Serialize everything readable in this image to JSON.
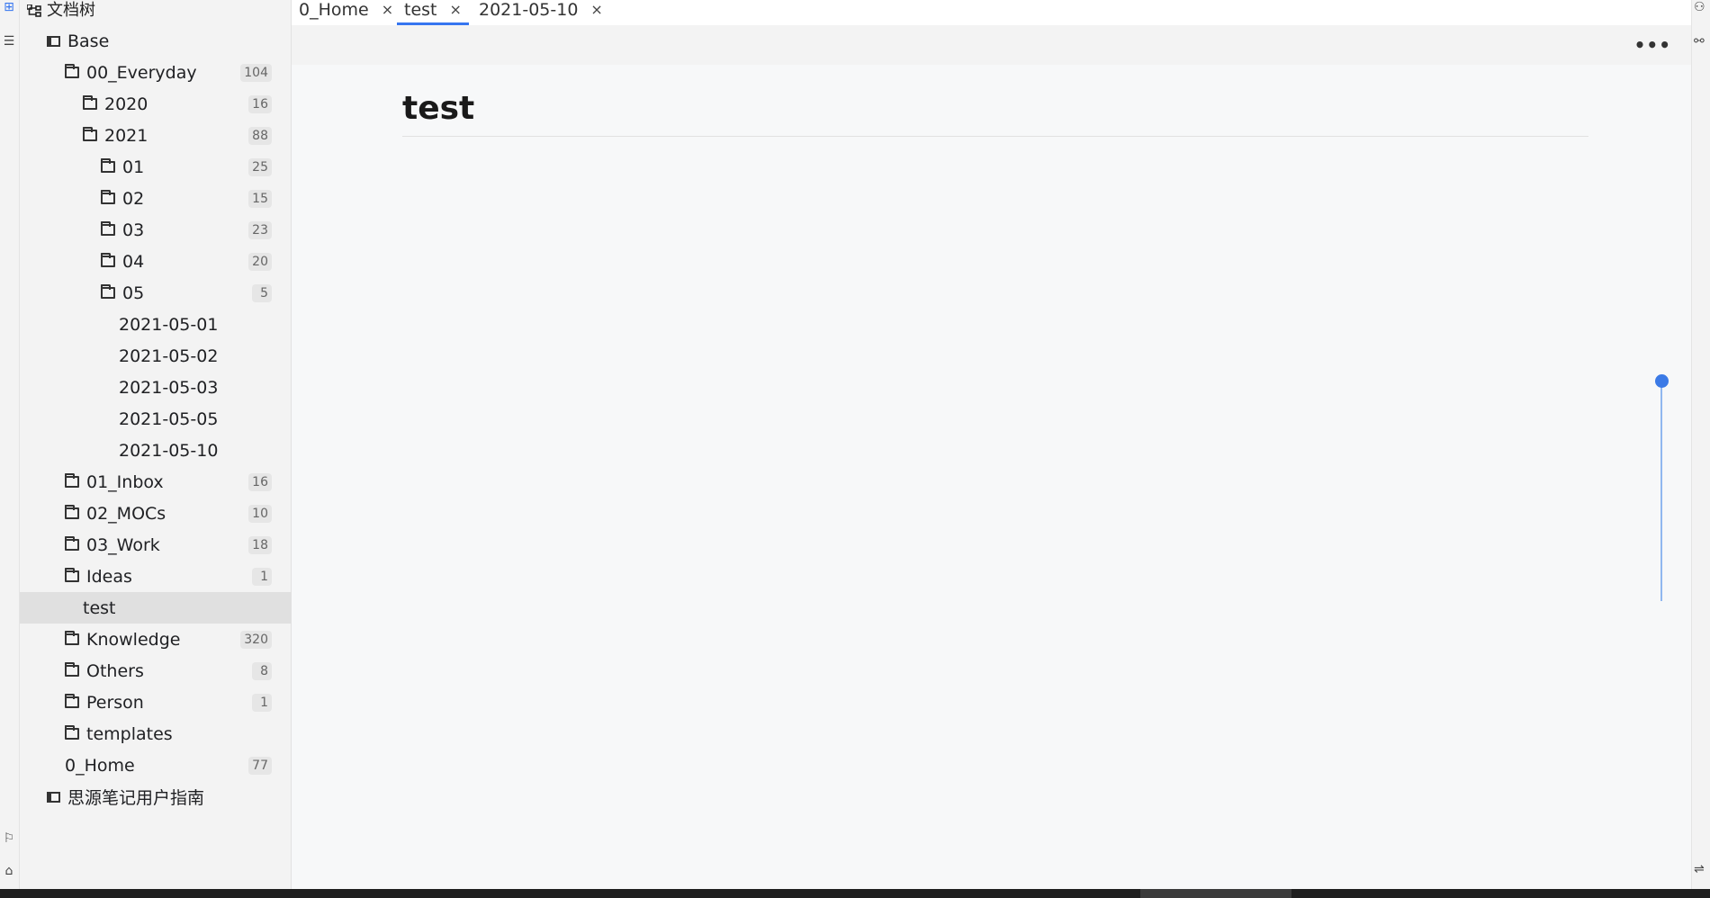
{
  "sidebar": {
    "title": "文档树",
    "items": [
      {
        "label": "Base",
        "count": ""
      },
      {
        "label": "00_Everyday",
        "count": "104"
      },
      {
        "label": "2020",
        "count": "16"
      },
      {
        "label": "2021",
        "count": "88"
      },
      {
        "label": "01",
        "count": "25"
      },
      {
        "label": "02",
        "count": "15"
      },
      {
        "label": "03",
        "count": "23"
      },
      {
        "label": "04",
        "count": "20"
      },
      {
        "label": "05",
        "count": "5"
      },
      {
        "label": "2021-05-01",
        "count": ""
      },
      {
        "label": "2021-05-02",
        "count": ""
      },
      {
        "label": "2021-05-03",
        "count": ""
      },
      {
        "label": "2021-05-05",
        "count": ""
      },
      {
        "label": "2021-05-10",
        "count": ""
      },
      {
        "label": "01_Inbox",
        "count": "16"
      },
      {
        "label": "02_MOCs",
        "count": "10"
      },
      {
        "label": "03_Work",
        "count": "18"
      },
      {
        "label": "Ideas",
        "count": "1"
      },
      {
        "label": "test",
        "count": ""
      },
      {
        "label": "Knowledge",
        "count": "320"
      },
      {
        "label": "Others",
        "count": "8"
      },
      {
        "label": "Person",
        "count": "1"
      },
      {
        "label": "templates",
        "count": ""
      },
      {
        "label": "0_Home",
        "count": "77"
      },
      {
        "label": "思源笔记用户指南",
        "count": ""
      }
    ]
  },
  "tabs": [
    {
      "label": "0_Home",
      "close": "×"
    },
    {
      "label": "test",
      "close": "×"
    },
    {
      "label": "2021-05-10",
      "close": "×"
    }
  ],
  "toolbar": {
    "more": "•••"
  },
  "editor": {
    "title": "test"
  },
  "accent_color": "#3575f0"
}
